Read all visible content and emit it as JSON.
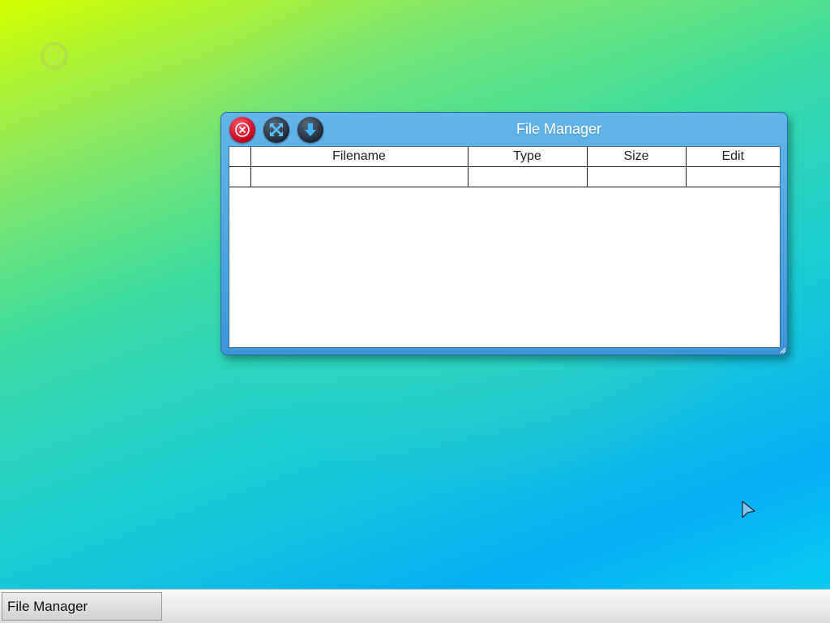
{
  "window": {
    "title": "File Manager",
    "buttons": {
      "close_icon": "close-icon",
      "maximize_icon": "maximize-icon",
      "minimize_icon": "minimize-icon"
    },
    "table": {
      "columns": [
        "",
        "Filename",
        "Type",
        "Size",
        "Edit"
      ],
      "rows": [
        [
          "",
          "",
          "",
          "",
          ""
        ]
      ]
    }
  },
  "taskbar": {
    "items": [
      {
        "label": "File Manager"
      }
    ]
  },
  "colors": {
    "titlebar": "#4fa6e2",
    "close_button": "#d0021b",
    "taskbar": "#e8e8e8"
  }
}
